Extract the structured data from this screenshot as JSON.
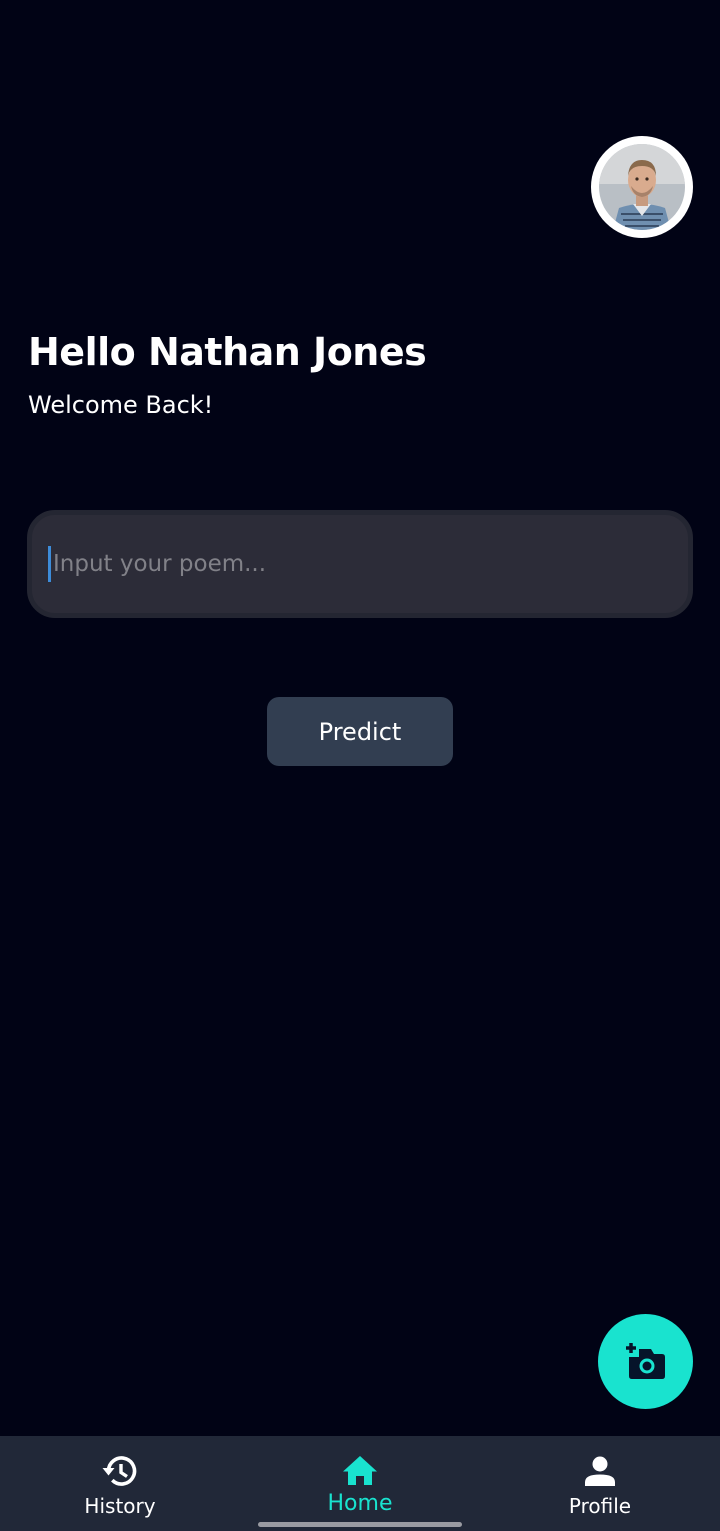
{
  "header": {
    "greeting": "Hello Nathan Jones",
    "subtitle": "Welcome Back!"
  },
  "avatar": {
    "icon": "user-profile-photo"
  },
  "poem_input": {
    "placeholder": "Input your poem...",
    "value": ""
  },
  "predict_button": {
    "label": "Predict"
  },
  "fab": {
    "icon": "add-photo-camera-icon"
  },
  "bottom_nav": {
    "items": [
      {
        "label": "History",
        "icon": "history-icon",
        "active": false
      },
      {
        "label": "Home",
        "icon": "home-icon",
        "active": true
      },
      {
        "label": "Profile",
        "icon": "person-icon",
        "active": false
      }
    ]
  },
  "colors": {
    "background": "#010315",
    "accent": "#19e3cf",
    "nav_background": "#212838",
    "input_background": "#2c2c38",
    "button_background": "#323e51",
    "caret": "#3d8cd9"
  }
}
